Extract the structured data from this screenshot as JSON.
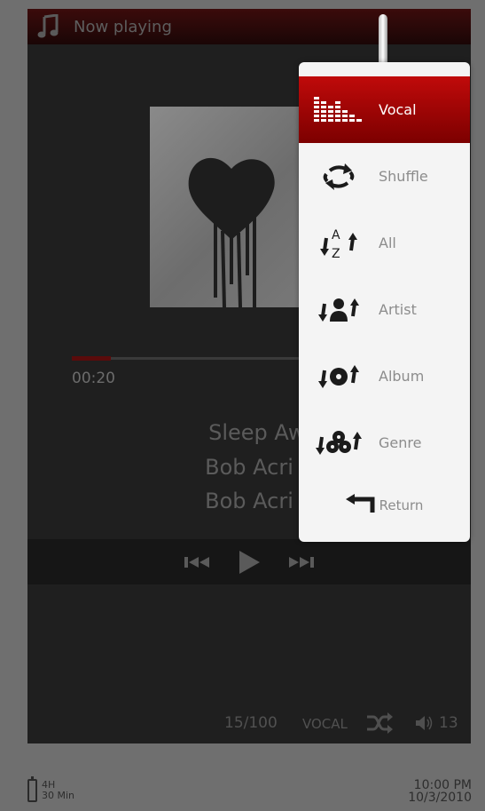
{
  "header": {
    "title": "Now playing",
    "icon": "music-note-icon"
  },
  "player": {
    "time_elapsed": "00:20",
    "progress_fraction": 0.11,
    "track_title": "Sleep Away.m",
    "track_artist": "Bob Acri",
    "track_album": "Bob Acri"
  },
  "controls": [
    "previous-icon",
    "play-icon",
    "next-icon"
  ],
  "footer": {
    "counter": "15/100",
    "mode": "VOCAL",
    "volume": "13"
  },
  "status": {
    "battery_hours": "4H",
    "battery_minutes": "30 Min",
    "time": "10:00 PM",
    "date": "10/3/2010"
  },
  "menu": {
    "items": [
      {
        "label": "Vocal",
        "icon": "equalizer-icon",
        "active": true
      },
      {
        "label": "Shuffle",
        "icon": "shuffle-repeat-icon",
        "active": false
      },
      {
        "label": "All",
        "icon": "az-repeat-icon",
        "active": false
      },
      {
        "label": "Artist",
        "icon": "artist-repeat-icon",
        "active": false
      },
      {
        "label": "Album",
        "icon": "album-repeat-icon",
        "active": false
      },
      {
        "label": "Genre",
        "icon": "genre-repeat-icon",
        "active": false
      }
    ],
    "return_label": "Return"
  },
  "colors": {
    "accent": "#b40a0a",
    "menu_bg": "#f4f4f4",
    "screen_bg": "#1f1f1f"
  }
}
